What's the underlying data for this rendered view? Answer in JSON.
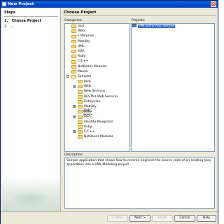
{
  "window": {
    "title": "New Project"
  },
  "steps": {
    "heading": "Steps",
    "items": [
      {
        "num": "1.",
        "label": "Choose Project"
      },
      {
        "num": "2.",
        "label": "..."
      }
    ]
  },
  "main": {
    "title": "Choose Project",
    "categories_label": "Categories:",
    "projects_label": "Projects:",
    "description_label": "Description:",
    "description": "Sample application that shows how to reverse-engineer the source code of an existing Java application into a UML Modeling project",
    "categories": [
      {
        "label": "Java",
        "depth": 0,
        "expander": "",
        "open": false,
        "selected": false
      },
      {
        "label": "Web",
        "depth": 0,
        "expander": "",
        "open": false,
        "selected": false
      },
      {
        "label": "Enterprise",
        "depth": 0,
        "expander": "",
        "open": false,
        "selected": false
      },
      {
        "label": "Mobility",
        "depth": 0,
        "expander": "",
        "open": false,
        "selected": false
      },
      {
        "label": "UML",
        "depth": 0,
        "expander": "",
        "open": false,
        "selected": false
      },
      {
        "label": "SOA",
        "depth": 0,
        "expander": "",
        "open": false,
        "selected": false
      },
      {
        "label": "Ruby",
        "depth": 0,
        "expander": "",
        "open": false,
        "selected": false
      },
      {
        "label": "C/C++",
        "depth": 0,
        "expander": "",
        "open": false,
        "selected": false
      },
      {
        "label": "NetBeans Modules",
        "depth": 0,
        "expander": "",
        "open": false,
        "selected": false
      },
      {
        "label": "Maven",
        "depth": 0,
        "expander": "",
        "open": false,
        "selected": false
      },
      {
        "label": "Samples",
        "depth": 0,
        "expander": "−",
        "open": true,
        "selected": false
      },
      {
        "label": "Java",
        "depth": 1,
        "expander": "",
        "open": false,
        "selected": false
      },
      {
        "label": "Web",
        "depth": 1,
        "expander": "+",
        "open": false,
        "selected": false
      },
      {
        "label": "Web Services",
        "depth": 1,
        "expander": "",
        "open": false,
        "selected": false
      },
      {
        "label": "RESTful Web Services",
        "depth": 1,
        "expander": "",
        "open": false,
        "selected": false
      },
      {
        "label": "Enterprise",
        "depth": 1,
        "expander": "",
        "open": false,
        "selected": false
      },
      {
        "label": "Mobility",
        "depth": 1,
        "expander": "+",
        "open": false,
        "selected": false
      },
      {
        "label": "UML",
        "depth": 1,
        "expander": "",
        "open": false,
        "selected": true
      },
      {
        "label": "SOA",
        "depth": 1,
        "expander": "+",
        "open": false,
        "selected": false
      },
      {
        "label": "Identity Blueprints",
        "depth": 1,
        "expander": "",
        "open": false,
        "selected": false
      },
      {
        "label": "Ruby",
        "depth": 1,
        "expander": "",
        "open": false,
        "selected": false
      },
      {
        "label": "C/C++",
        "depth": 1,
        "expander": "+",
        "open": false,
        "selected": false
      },
      {
        "label": "NetBeans Modules",
        "depth": 1,
        "expander": "",
        "open": false,
        "selected": false
      }
    ],
    "projects": [
      {
        "label": "UML Bank App Sample",
        "selected": true
      }
    ]
  },
  "buttons": {
    "back": "< Back",
    "next": "Next >",
    "finish": "Finish",
    "cancel": "Cancel",
    "help": "Help"
  },
  "colors": {
    "titlebar": "#0a5fd8",
    "selection": "#316ac5",
    "folder": "#f5d76e",
    "window_bg": "#ece9d8"
  }
}
